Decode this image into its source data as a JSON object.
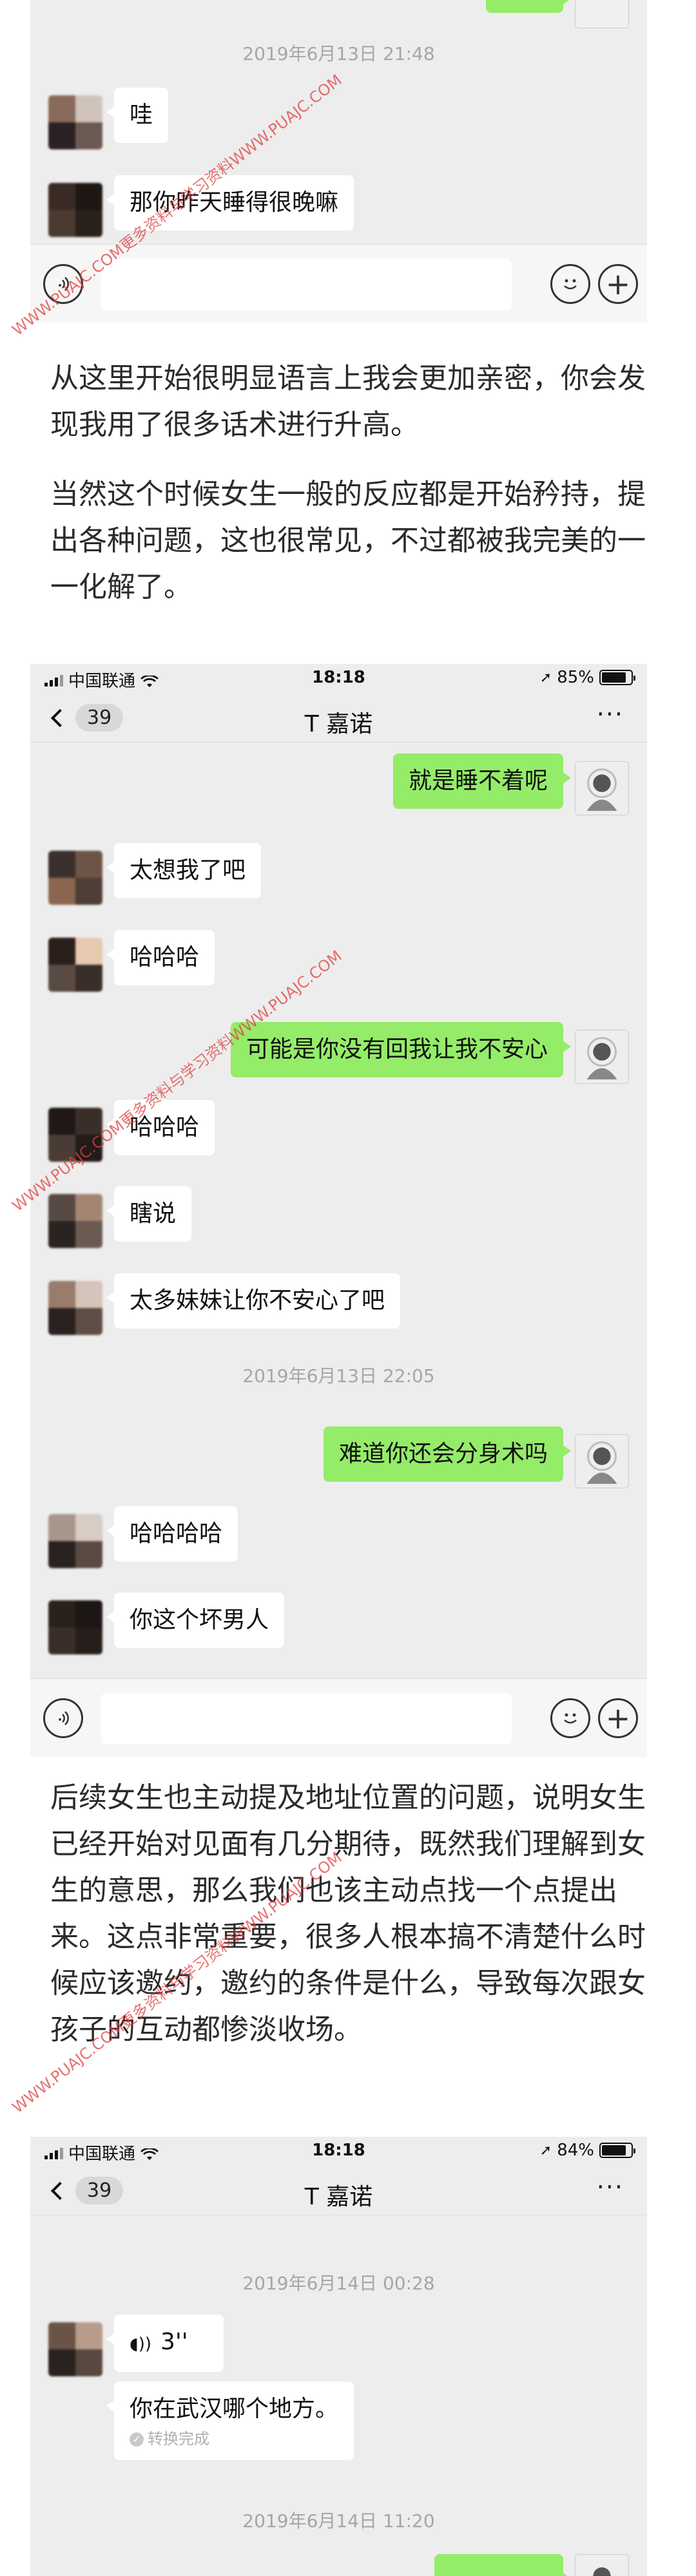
{
  "top_section": {
    "timestamp": "2019年6月13日 21:48",
    "messages": [
      {
        "side": "in",
        "text": "哇"
      },
      {
        "side": "in",
        "text": "那你昨天睡得很晚嘛"
      }
    ]
  },
  "article": {
    "para1": "从这里开始很明显语言上我会更加亲密，你会发现我用了很多话术进行升高。",
    "para2": "当然这个时候女生一般的反应都是开始矜持，提出各种问题，这也很常见，不过都被我完美的一一化解了。",
    "para3": "后续女生也主动提及地址位置的问题，说明女生已经开始对见面有几分期待，既然我们理解到女生的意思，那么我们也该主动点找一个点提出来。这点非常重要，很多人根本搞不清楚什么时候应该邀约，邀约的条件是什么，导致每次跟女孩子的互动都惨淡收场。"
  },
  "chat_mid": {
    "status": {
      "carrier": "中国联通",
      "time": "18:18",
      "battery": "85%",
      "battery_level": 0.85
    },
    "nav": {
      "back_count": "39",
      "title": "T 嘉诺",
      "more": "···"
    },
    "messages": [
      {
        "side": "out",
        "text": "就是睡不着呢"
      },
      {
        "side": "in",
        "text": "太想我了吧"
      },
      {
        "side": "in",
        "text": "哈哈哈"
      },
      {
        "side": "out",
        "text": "可能是你没有回我让我不安心"
      },
      {
        "side": "in",
        "text": "哈哈哈"
      },
      {
        "side": "in",
        "text": "瞎说"
      },
      {
        "side": "in",
        "text": "太多妹妹让你不安心了吧"
      },
      {
        "side": "out",
        "text": "难道你还会分身术吗"
      },
      {
        "side": "in",
        "text": "哈哈哈哈"
      },
      {
        "side": "in",
        "text": "你这个坏男人"
      }
    ],
    "timestamp": "2019年6月13日 22:05"
  },
  "chat_bottom": {
    "status": {
      "carrier": "中国联通",
      "time": "18:18",
      "battery": "84%",
      "battery_level": 0.84
    },
    "nav": {
      "back_count": "39",
      "title": "T 嘉诺",
      "more": "···"
    },
    "timestamp1": "2019年6月14日 00:28",
    "voice_duration": "3''",
    "voice_transcript": "你在武汉哪个地方。",
    "transcript_status": "转换完成",
    "timestamp2": "2019年6月14日 11:20"
  },
  "watermark": "WWW.PUAJC.COM更多资料与学习资料WWW.PUAJC.COM",
  "colors": {
    "bubble_out": "#95ec69",
    "bubble_in": "#ffffff",
    "chat_bg": "#ededed",
    "timestamp": "#a6a6a6"
  },
  "icons": [
    "voice-icon",
    "emoji-icon",
    "plus-icon",
    "back-chevron-icon",
    "more-icon",
    "wifi-icon",
    "signal-icon",
    "battery-icon",
    "location-arrow-icon",
    "sound-wave-icon",
    "check-icon"
  ]
}
